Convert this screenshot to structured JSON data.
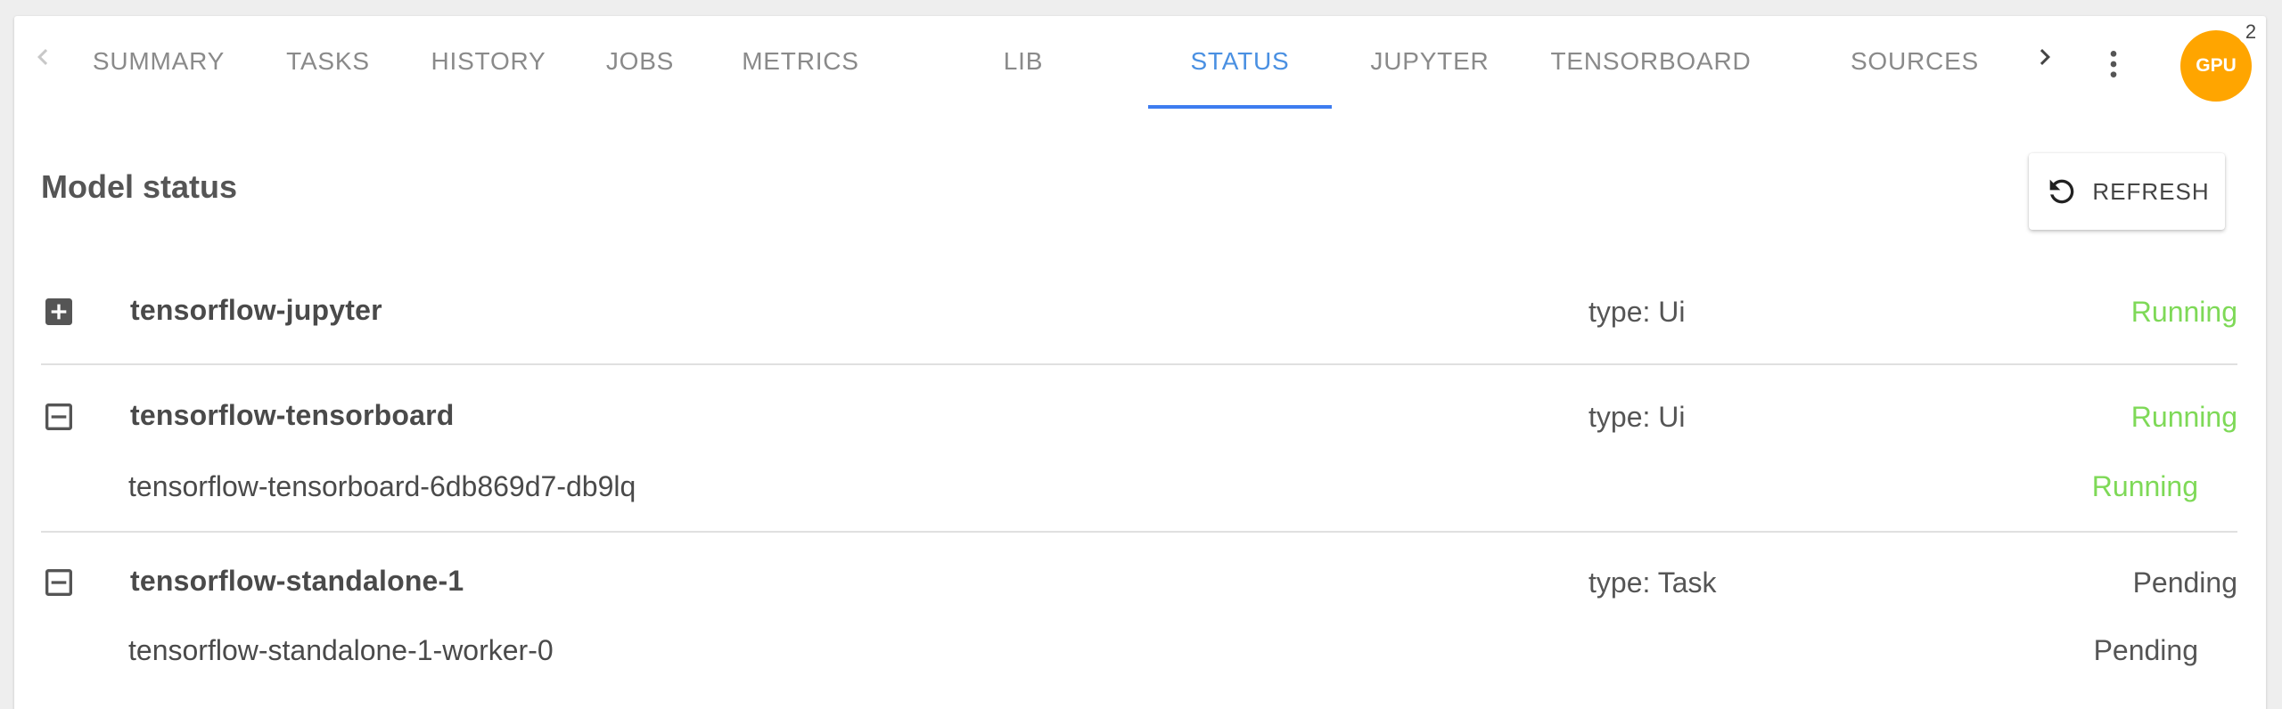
{
  "tabs": [
    {
      "label": "SUMMARY",
      "active": false
    },
    {
      "label": "TASKS",
      "active": false
    },
    {
      "label": "HISTORY",
      "active": false
    },
    {
      "label": "JOBS",
      "active": false
    },
    {
      "label": "METRICS",
      "active": false
    },
    {
      "label": "LIB",
      "active": false
    },
    {
      "label": "STATUS",
      "active": true
    },
    {
      "label": "JUPYTER",
      "active": false
    },
    {
      "label": "TENSORBOARD",
      "active": false
    },
    {
      "label": "SOURCES",
      "active": false
    }
  ],
  "icons": {
    "scroll_left": "chevron-left-icon",
    "scroll_right": "chevron-right-icon",
    "more": "more-vertical-icon",
    "refresh": "refresh-icon",
    "expand": "plus-box-icon",
    "collapse": "minus-box-icon"
  },
  "avatar": {
    "label": "GPU",
    "badge": "2",
    "color": "#ffa500"
  },
  "colors": {
    "accent": "#4a90e2",
    "running": "#7ed957",
    "pending": "#555555"
  },
  "main": {
    "title": "Model status",
    "refresh_label": "REFRESH",
    "models": [
      {
        "name": "tensorflow-jupyter",
        "type": "type: Ui",
        "status": "Running",
        "expanded": false,
        "pods": []
      },
      {
        "name": "tensorflow-tensorboard",
        "type": "type: Ui",
        "status": "Running",
        "expanded": true,
        "pods": [
          {
            "name": "tensorflow-tensorboard-6db869d7-db9lq",
            "status": "Running"
          }
        ]
      },
      {
        "name": "tensorflow-standalone-1",
        "type": "type: Task",
        "status": "Pending",
        "expanded": true,
        "pods": [
          {
            "name": "tensorflow-standalone-1-worker-0",
            "status": "Pending"
          }
        ]
      }
    ]
  }
}
